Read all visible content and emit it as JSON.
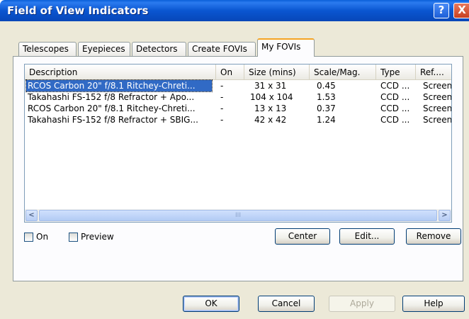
{
  "window": {
    "title": "Field of View Indicators",
    "help_glyph": "?",
    "close_glyph": "X"
  },
  "tabs": [
    {
      "label": "Telescopes"
    },
    {
      "label": "Eyepieces"
    },
    {
      "label": "Detectors"
    },
    {
      "label": "Create FOVIs"
    },
    {
      "label": "My FOVIs",
      "active": true
    }
  ],
  "list": {
    "columns": [
      "Description",
      "On",
      "Size (mins)",
      "Scale/Mag.",
      "Type",
      "Ref...."
    ],
    "rows": [
      {
        "description": "RCOS Carbon 20\" f/8.1 Ritchey-Chreti...",
        "on": "-",
        "size": "31 x 31",
        "scale": "0.45",
        "type": "CCD ...",
        "ref": "Screen",
        "selected": true
      },
      {
        "description": "Takahashi FS-152 f/8 Refractor + Apo...",
        "on": "-",
        "size": "104 x 104",
        "scale": "1.53",
        "type": "CCD ...",
        "ref": "Screen"
      },
      {
        "description": "RCOS Carbon 20\" f/8.1 Ritchey-Chreti...",
        "on": "-",
        "size": "13 x 13",
        "scale": "0.37",
        "type": "CCD ...",
        "ref": "Screen"
      },
      {
        "description": "Takahashi FS-152 f/8 Refractor + SBIG...",
        "on": "-",
        "size": "42 x 42",
        "scale": "1.24",
        "type": "CCD ...",
        "ref": "Screen"
      }
    ],
    "scroll_left_glyph": "<",
    "scroll_right_glyph": ">",
    "thumb_grip": "III"
  },
  "options": {
    "on_label": "On",
    "preview_label": "Preview",
    "on_checked": false,
    "preview_checked": false
  },
  "actions": {
    "center": "Center",
    "edit": "Edit...",
    "remove": "Remove"
  },
  "footer": {
    "ok": "OK",
    "cancel": "Cancel",
    "apply": "Apply",
    "help": "Help"
  },
  "colors": {
    "titlebar": "#0a56d1",
    "selection": "#316ac5",
    "dialog_bg": "#ece9d8",
    "active_tab_accent": "#f5a323"
  }
}
